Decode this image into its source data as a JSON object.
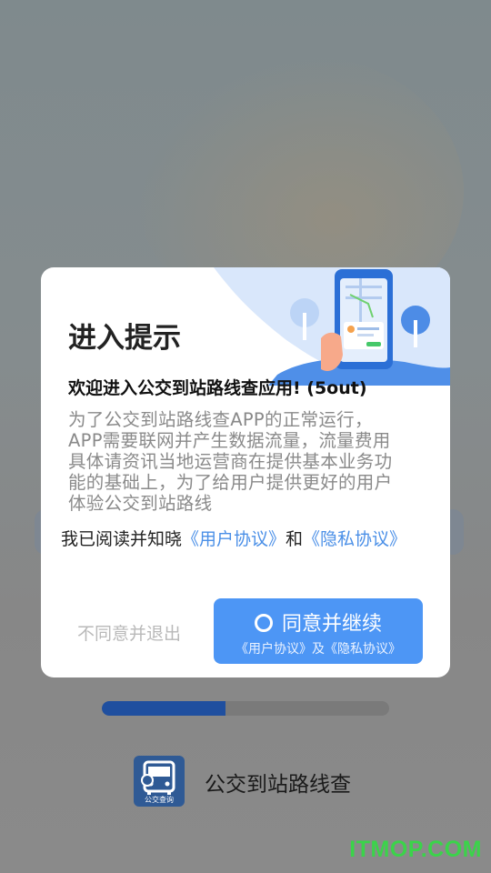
{
  "dialog": {
    "title": "进入提示",
    "welcome": "欢迎进入公交到站路线查应用! (5out)",
    "body": "为了公交到站路线查APP的正常运行，APP需要联网并产生数据流量，流量费用具体请资讯当地运营商在提供基本业务功能的基础上，为了给用户提供更好的用户体验公交到站路线",
    "consent_prefix": "我已阅读并知晓",
    "user_agreement_link": "《用户协议》",
    "consent_and": "和",
    "privacy_link": "《隐私协议》",
    "decline_button": "不同意并退出",
    "agree_button": "同意并继续",
    "agree_subtext": "《用户协议》及《隐私协议》"
  },
  "loading": {
    "progress_fraction": 0.43
  },
  "app": {
    "name": "公交到站路线查",
    "logo_caption": "公交查询",
    "icon": "bus-icon"
  },
  "watermark": "ITMOP.COM",
  "colors": {
    "accent": "#4d96f5",
    "link": "#4a8fe7",
    "progress": "#1f4f9f",
    "watermark": "#3bd34a"
  }
}
